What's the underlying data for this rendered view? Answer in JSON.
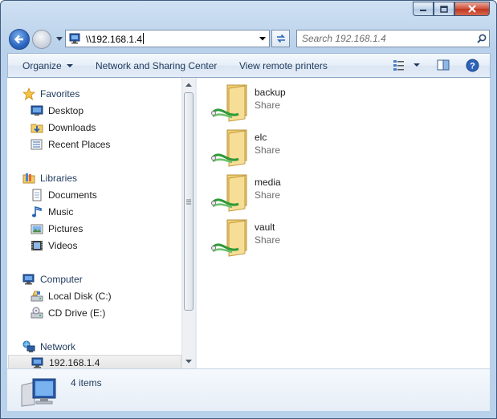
{
  "window": {
    "caption_buttons": [
      "minimize-icon",
      "maximize-icon",
      "close-icon"
    ]
  },
  "address_bar": {
    "path": "\\\\192.168.1.4",
    "icon": "network-computer-icon"
  },
  "search": {
    "placeholder": "Search 192.168.1.4"
  },
  "command_bar": {
    "organize": "Organize",
    "network_sharing": "Network and Sharing Center",
    "view_printers": "View remote printers"
  },
  "nav_pane": {
    "favorites": {
      "label": "Favorites",
      "items": [
        {
          "label": "Desktop",
          "icon": "desktop-icon"
        },
        {
          "label": "Downloads",
          "icon": "downloads-icon"
        },
        {
          "label": "Recent Places",
          "icon": "recent-places-icon"
        }
      ]
    },
    "libraries": {
      "label": "Libraries",
      "items": [
        {
          "label": "Documents",
          "icon": "documents-icon"
        },
        {
          "label": "Music",
          "icon": "music-icon"
        },
        {
          "label": "Pictures",
          "icon": "pictures-icon"
        },
        {
          "label": "Videos",
          "icon": "videos-icon"
        }
      ]
    },
    "computer": {
      "label": "Computer",
      "items": [
        {
          "label": "Local Disk (C:)",
          "icon": "local-disk-icon"
        },
        {
          "label": "CD Drive (E:)",
          "icon": "cd-drive-icon"
        }
      ]
    },
    "network": {
      "label": "Network",
      "items": [
        {
          "label": "192.168.1.4",
          "icon": "network-computer-icon",
          "selected": true
        }
      ]
    }
  },
  "shares": [
    {
      "name": "backup",
      "type": "Share"
    },
    {
      "name": "elc",
      "type": "Share"
    },
    {
      "name": "media",
      "type": "Share"
    },
    {
      "name": "vault",
      "type": "Share"
    }
  ],
  "details": {
    "count": "4 items"
  },
  "colors": {
    "link_text": "#1e395b",
    "secondary_text": "#6d6d6d",
    "frame": "#b9d1ea"
  }
}
